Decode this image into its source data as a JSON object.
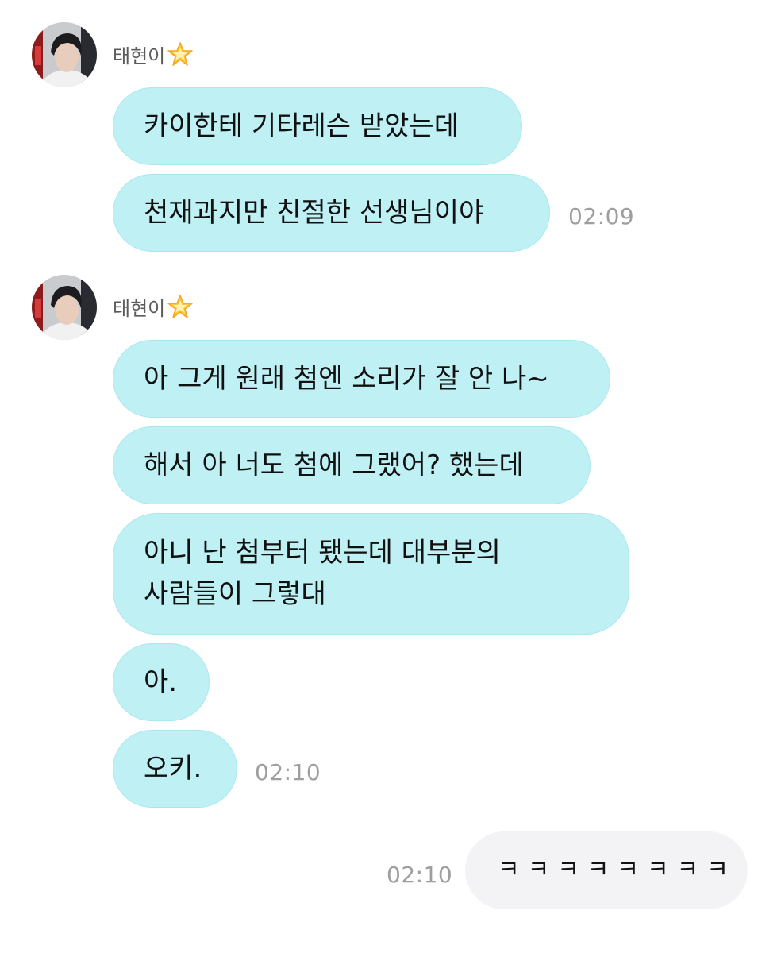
{
  "chat": {
    "sender_name": "태현이",
    "groups": [
      {
        "sender": "태현이",
        "messages": [
          "카이한테 기타레슨 받았는데",
          "천재과지만 친절한 선생님이야"
        ],
        "time": "02:09"
      },
      {
        "sender": "태현이",
        "messages": [
          "아 그게 원래 첨엔 소리가 잘 안 나~",
          "해서 아 너도 첨에 그랬어? 했는데",
          "아니 난 첨부터 됐는데 대부분의 사람들이 그렇대",
          "아.",
          "오키."
        ],
        "time": "02:10"
      }
    ],
    "my_message": {
      "text": "ㅋㅋㅋㅋㅋㅋㅋㅋ",
      "time": "02:10"
    }
  },
  "icons": {
    "avatar": "profile-photo",
    "badge": "glowing-star-emoji"
  },
  "colors": {
    "incoming_bubble": "#bef0f4",
    "outgoing_bubble": "#f3f3f6",
    "timestamp": "#9e9e9e",
    "sender_name": "#5b5b5b"
  }
}
